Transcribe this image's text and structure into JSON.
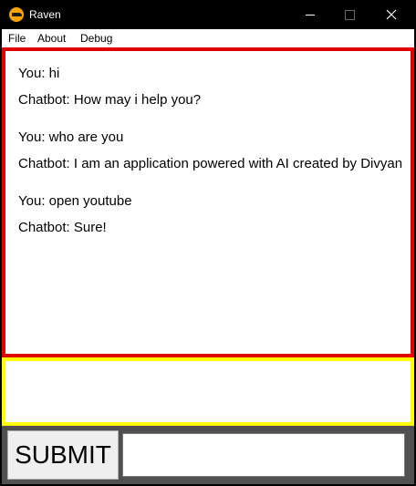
{
  "window": {
    "title": "Raven",
    "icon": "raven-app-icon"
  },
  "menubar": {
    "items": [
      "File",
      "About",
      "Debug"
    ]
  },
  "chat": {
    "messages": [
      {
        "text": "You: hi"
      },
      {
        "text": "Chatbot: How may i help you?"
      },
      {
        "text": "You: who are you"
      },
      {
        "text": "Chatbot: I am an application powered with AI created by Divyan"
      },
      {
        "text": "You: open youtube"
      },
      {
        "text": "Chatbot: Sure!"
      }
    ]
  },
  "controls": {
    "submit_label": "SUBMIT",
    "entry_value": ""
  },
  "colors": {
    "chat_border": "#e00000",
    "input_border": "#ffff00",
    "bottom_bar": "#505050",
    "app_icon": "#f5a400"
  }
}
